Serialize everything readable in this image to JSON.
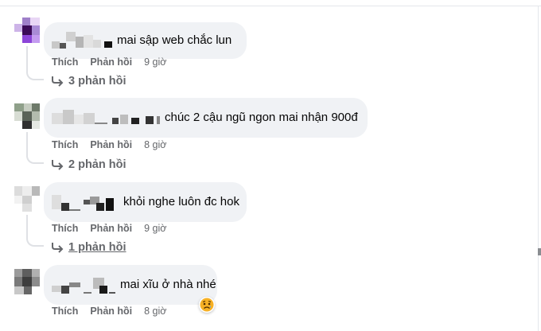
{
  "comments": [
    {
      "text": "mai sập web chắc lun",
      "like_label": "Thích",
      "reply_label": "Phản hồi",
      "time": "9 giờ",
      "replies_label": "3 phản hồi"
    },
    {
      "text": "chúc 2 cậu ngũ ngon mai nhận 900đ",
      "like_label": "Thích",
      "reply_label": "Phản hồi",
      "time": "8 giờ",
      "replies_label": "2 phản hồi"
    },
    {
      "text": "khỏi nghe luôn đc hok",
      "like_label": "Thích",
      "reply_label": "Phản hồi",
      "time": "9 giờ",
      "replies_label": "1 phản hồi"
    },
    {
      "text": "mai xĩu ở nhà nhé",
      "like_label": "Thích",
      "reply_label": "Phản hồi",
      "time": "8 giờ",
      "reaction_icon": "sad-reaction-icon"
    }
  ],
  "colors": {
    "bubble": "#f0f2f5",
    "meta": "#65676b",
    "text": "#050505",
    "reaction": "#f7b125"
  }
}
